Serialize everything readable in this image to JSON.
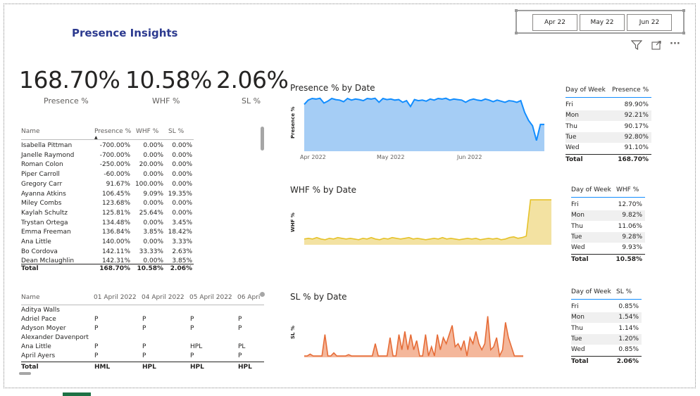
{
  "title": "Presence Insights",
  "slicer": {
    "buttons": [
      "Apr 22",
      "May 22",
      "Jun 22"
    ]
  },
  "kpis": [
    {
      "value": "168.70%",
      "label": "Presence %"
    },
    {
      "value": "10.58%",
      "label": "WHF %"
    },
    {
      "value": "2.06%",
      "label": "SL %"
    }
  ],
  "name_table": {
    "headers": [
      "Name",
      "Presence %",
      "WHF %",
      "SL %"
    ],
    "sort_indicator": "▲",
    "rows": [
      [
        "Isabella Pittman",
        "-700.00%",
        "0.00%",
        "0.00%"
      ],
      [
        "Janelle Raymond",
        "-700.00%",
        "0.00%",
        "0.00%"
      ],
      [
        "Roman Colon",
        "-250.00%",
        "20.00%",
        "0.00%"
      ],
      [
        "Piper Carroll",
        "-60.00%",
        "0.00%",
        "0.00%"
      ],
      [
        "Gregory Carr",
        "91.67%",
        "100.00%",
        "0.00%"
      ],
      [
        "Ayanna Atkins",
        "106.45%",
        "9.09%",
        "19.35%"
      ],
      [
        "Miley Combs",
        "123.68%",
        "0.00%",
        "0.00%"
      ],
      [
        "Kaylah Schultz",
        "125.81%",
        "25.64%",
        "0.00%"
      ],
      [
        "Trystan Ortega",
        "134.48%",
        "0.00%",
        "3.45%"
      ],
      [
        "Emma Freeman",
        "136.84%",
        "3.85%",
        "18.42%"
      ],
      [
        "Ana Little",
        "140.00%",
        "0.00%",
        "3.33%"
      ],
      [
        "Bo Cordova",
        "142.11%",
        "33.33%",
        "2.63%"
      ],
      [
        "Dean Mclaughlin",
        "142.31%",
        "0.00%",
        "3.85%"
      ]
    ],
    "total": [
      "Total",
      "168.70%",
      "10.58%",
      "2.06%"
    ]
  },
  "attendance_table": {
    "headers": [
      "Name",
      "01 April 2022",
      "04 April 2022",
      "05 April 2022",
      "06 Apri"
    ],
    "rows": [
      [
        "Aditya Walls",
        "",
        "",
        "",
        ""
      ],
      [
        "Adriel Pace",
        "P",
        "P",
        "P",
        "P"
      ],
      [
        "Adyson Moyer",
        "P",
        "P",
        "P",
        "P"
      ],
      [
        "Alexander Davenport",
        "",
        "",
        "",
        ""
      ],
      [
        "Ana Little",
        "P",
        "P",
        "HPL",
        "PL"
      ],
      [
        "April Ayers",
        "P",
        "P",
        "P",
        "P"
      ]
    ],
    "total": [
      "Total",
      "HML",
      "HPL",
      "HPL",
      "HPL"
    ]
  },
  "presence_chart": {
    "title": "Presence % by Date",
    "ylabel": "Presence %",
    "x_ticks": [
      "Apr 2022",
      "May 2022",
      "Jun 2022"
    ],
    "color": "#118dff",
    "fill": "#a5cdf5"
  },
  "whf_chart": {
    "title": "WHF % by Date",
    "ylabel": "WHF %",
    "color": "#e6c229",
    "fill": "#f3e2a2"
  },
  "sl_chart": {
    "title": "SL % by Date",
    "ylabel": "SL %",
    "color": "#e66c37",
    "fill": "#f4b79b"
  },
  "chart_data": [
    {
      "type": "area",
      "title": "Presence % by Date",
      "xlabel": "",
      "ylabel": "Presence %",
      "x_ticks": [
        "Apr 2022",
        "May 2022",
        "Jun 2022"
      ],
      "values": [
        1.7,
        1.86,
        1.92,
        1.9,
        1.93,
        1.75,
        1.82,
        1.92,
        1.88,
        1.86,
        1.8,
        1.92,
        1.86,
        1.9,
        1.88,
        1.84,
        1.92,
        1.9,
        1.93,
        1.78,
        1.92,
        1.88,
        1.9,
        1.86,
        1.88,
        1.78,
        1.84,
        1.62,
        1.88,
        1.84,
        1.86,
        1.82,
        1.9,
        1.86,
        1.92,
        1.9,
        1.93,
        1.86,
        1.9,
        1.88,
        1.86,
        1.78,
        1.86,
        1.9,
        1.86,
        1.84,
        1.9,
        1.86,
        1.8,
        1.86,
        1.82,
        1.78,
        1.84,
        1.82,
        1.78,
        1.84,
        1.4,
        1.1,
        0.9,
        0.35,
        0.95,
        0.95
      ]
    },
    {
      "type": "area",
      "title": "WHF % by Date",
      "xlabel": "",
      "ylabel": "WHF %",
      "values": [
        0.06,
        0.07,
        0.06,
        0.08,
        0.06,
        0.05,
        0.07,
        0.06,
        0.08,
        0.07,
        0.06,
        0.07,
        0.06,
        0.05,
        0.07,
        0.06,
        0.08,
        0.06,
        0.05,
        0.07,
        0.06,
        0.08,
        0.07,
        0.06,
        0.07,
        0.08,
        0.06,
        0.07,
        0.06,
        0.05,
        0.06,
        0.07,
        0.06,
        0.08,
        0.06,
        0.07,
        0.06,
        0.05,
        0.06,
        0.07,
        0.06,
        0.07,
        0.05,
        0.06,
        0.07,
        0.06,
        0.07,
        0.05,
        0.06,
        0.08,
        0.09,
        0.07,
        0.08,
        0.1,
        0.6,
        0.6,
        0.6,
        0.6,
        0.6,
        0.6
      ]
    },
    {
      "type": "area",
      "title": "SL % by Date",
      "xlabel": "",
      "ylabel": "SL %",
      "values": [
        0.0,
        0.0,
        0.03,
        0.0,
        0.0,
        0.0,
        0.0,
        0.35,
        0.0,
        0.0,
        0.05,
        0.0,
        0.0,
        0.0,
        0.0,
        0.02,
        0.0,
        0.0,
        0.0,
        0.0,
        0.0,
        0.0,
        0.0,
        0.0,
        0.2,
        0.0,
        0.0,
        0.0,
        0.0,
        0.3,
        0.0,
        0.0,
        0.35,
        0.1,
        0.4,
        0.1,
        0.35,
        0.1,
        0.25,
        0.0,
        0.0,
        0.35,
        0.0,
        0.15,
        0.0,
        0.35,
        0.1,
        0.3,
        0.2,
        0.35,
        0.5,
        0.15,
        0.2,
        0.1,
        0.25,
        0.0,
        0.3,
        0.2,
        0.4,
        0.2,
        0.1,
        0.2,
        0.65,
        0.1,
        0.15,
        0.3,
        0.0,
        0.1,
        0.55,
        0.3,
        0.15,
        0.0,
        0.0,
        0.0,
        0.0
      ]
    }
  ],
  "dow_presence": {
    "headers": [
      "Day of Week",
      "Presence %"
    ],
    "rows": [
      [
        "Fri",
        "89.90%"
      ],
      [
        "Mon",
        "92.21%"
      ],
      [
        "Thu",
        "90.17%"
      ],
      [
        "Tue",
        "92.80%"
      ],
      [
        "Wed",
        "91.10%"
      ]
    ],
    "total": [
      "Total",
      "168.70%"
    ]
  },
  "dow_whf": {
    "headers": [
      "Day of Week",
      "WHF %"
    ],
    "rows": [
      [
        "Fri",
        "12.70%"
      ],
      [
        "Mon",
        "9.82%"
      ],
      [
        "Thu",
        "11.06%"
      ],
      [
        "Tue",
        "9.28%"
      ],
      [
        "Wed",
        "9.93%"
      ]
    ],
    "total": [
      "Total",
      "10.58%"
    ]
  },
  "dow_sl": {
    "headers": [
      "Day of Week",
      "SL %"
    ],
    "rows": [
      [
        "Fri",
        "0.85%"
      ],
      [
        "Mon",
        "1.54%"
      ],
      [
        "Thu",
        "1.14%"
      ],
      [
        "Tue",
        "1.20%"
      ],
      [
        "Wed",
        "0.85%"
      ]
    ],
    "total": [
      "Total",
      "2.06%"
    ]
  },
  "visual_header": {
    "filter_icon": "filter-icon",
    "focus_icon": "focus-mode-icon",
    "more_icon": "more-options-icon",
    "more_label": "···"
  }
}
